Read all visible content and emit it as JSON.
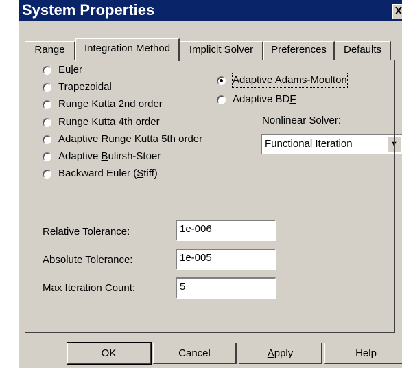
{
  "window": {
    "title": "System Properties",
    "close_label": "X"
  },
  "tabs": [
    {
      "label": "Range",
      "active": false
    },
    {
      "label": "Integration Method",
      "active": true
    },
    {
      "label": "Implicit Solver",
      "active": false
    },
    {
      "label": "Preferences",
      "active": false
    },
    {
      "label": "Defaults",
      "active": false
    }
  ],
  "methods": {
    "left": [
      {
        "before": "Eu",
        "key": "l",
        "after": "er",
        "selected": false
      },
      {
        "before": "",
        "key": "T",
        "after": "rapezoidal",
        "selected": false
      },
      {
        "before": "Runge Kutta ",
        "key": "2",
        "after": "nd order",
        "selected": false
      },
      {
        "before": "Runge Kutta ",
        "key": "4",
        "after": "th order",
        "selected": false
      },
      {
        "before": "Adaptive Runge Kutta ",
        "key": "5",
        "after": "th order",
        "selected": false
      },
      {
        "before": "Adaptive ",
        "key": "B",
        "after": "ulirsh-Stoer",
        "selected": false
      },
      {
        "before": "Backward Euler (",
        "key": "S",
        "after": "tiff)",
        "selected": false
      }
    ],
    "right": [
      {
        "before": "Adaptive ",
        "key": "A",
        "after": "dams-Moulton",
        "selected": true
      },
      {
        "before": "Adaptive BD",
        "key": "F",
        "after": "",
        "selected": false
      }
    ]
  },
  "nonlinear_solver": {
    "label": "Nonlinear Solver:",
    "value": "Functional Iteration"
  },
  "tolerances": {
    "relative": {
      "label": "Relative Tolerance:",
      "value": "1e-006"
    },
    "absolute": {
      "label": "Absolute Tolerance:",
      "value": "1e-005"
    },
    "max_iter": {
      "before": "Max ",
      "key": "I",
      "after": "teration Count:",
      "value": "5"
    }
  },
  "buttons": {
    "ok": "OK",
    "cancel": "Cancel",
    "apply": {
      "before": "",
      "key": "A",
      "after": "pply"
    },
    "help": "Help"
  }
}
